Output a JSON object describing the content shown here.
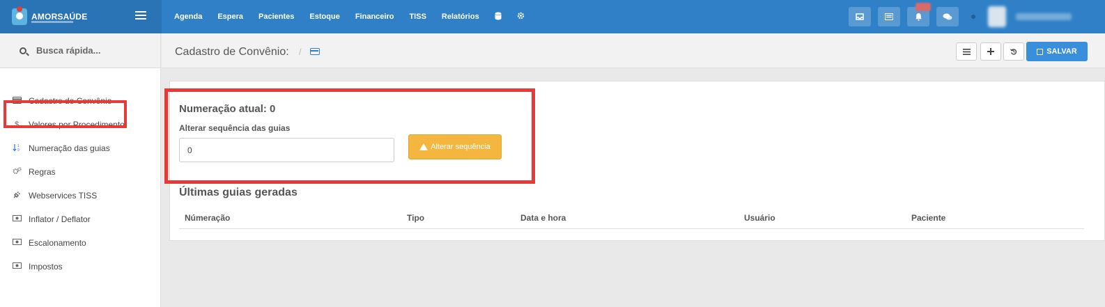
{
  "brand": {
    "name": "AMORSAÚDE"
  },
  "nav": {
    "items": [
      "Agenda",
      "Espera",
      "Pacientes",
      "Estoque",
      "Financeiro",
      "TISS",
      "Relatórios"
    ],
    "icons": [
      "database-icon",
      "gear-icon"
    ]
  },
  "topbar": {
    "buttons": [
      "inbox-icon",
      "list-alt-icon",
      "bell-icon",
      "chat-icon"
    ]
  },
  "sidebar": {
    "search_placeholder": "Busca rápida...",
    "items": [
      {
        "label": "Cadastro do Convênio",
        "icon": "credit-card-icon"
      },
      {
        "label": "Valores por Procedimento",
        "icon": "dollar-icon"
      },
      {
        "label": "Numeração das guias",
        "icon": "sort-numeric-icon",
        "active": true
      },
      {
        "label": "Regras",
        "icon": "cogs-icon"
      },
      {
        "label": "Webservices TISS",
        "icon": "plug-icon"
      },
      {
        "label": "Inflator / Deflator",
        "icon": "money-icon"
      },
      {
        "label": "Escalonamento",
        "icon": "money-icon"
      },
      {
        "label": "Impostos",
        "icon": "money-icon"
      }
    ]
  },
  "header": {
    "title": "Cadastro de Convênio:",
    "separator": "/",
    "save_label": "SALVAR"
  },
  "numeracao": {
    "title": "Numeração atual: 0",
    "label": "Alterar sequência das guias",
    "input_value": "0",
    "button_label": "Alterar sequência"
  },
  "ultimas": {
    "title": "Últimas guias geradas",
    "columns": [
      "Númeração",
      "Tipo",
      "Data e hora",
      "Usuário",
      "Paciente"
    ]
  },
  "colors": {
    "topbar": "#2f80c6",
    "highlight": "#e53a37",
    "warning_button": "#f4b63f",
    "save_button": "#3a8fdc"
  }
}
